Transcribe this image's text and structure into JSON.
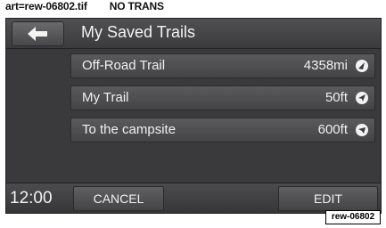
{
  "caption": "art=rew-06802.tif        NO TRANS",
  "header": {
    "title": "My Saved Trails",
    "back_icon": "back-arrow-icon"
  },
  "trails": [
    {
      "name": "Off-Road Trail",
      "distance": "4358mi",
      "icon": "compass-direction-icon"
    },
    {
      "name": "My Trail",
      "distance": "50ft",
      "icon": "compass-direction-icon"
    },
    {
      "name": "To the campsite",
      "distance": "600ft",
      "icon": "compass-direction-icon"
    }
  ],
  "footer": {
    "clock": "12:00",
    "cancel_label": "CANCEL",
    "edit_label": "EDIT"
  },
  "art_tag": "rew-06802"
}
